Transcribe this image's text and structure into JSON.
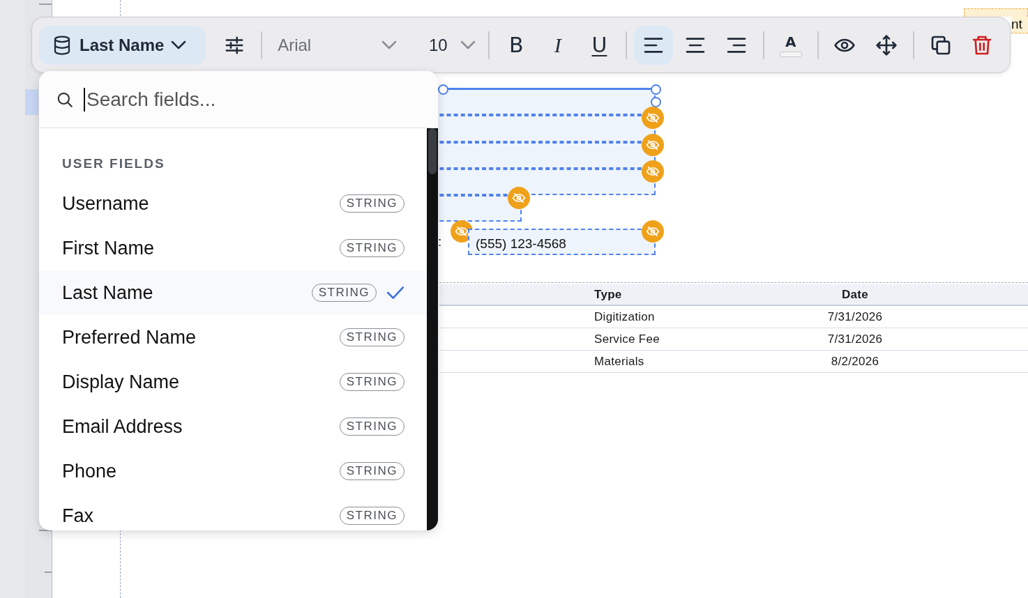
{
  "toolbar": {
    "field_button": {
      "label": "Last Name"
    },
    "font": {
      "value": "Arial"
    },
    "size": {
      "value": "10"
    },
    "tool_groups": [
      [
        {
          "kind": "bold",
          "glyph": "B"
        },
        {
          "kind": "italic",
          "glyph": "I"
        },
        {
          "kind": "underline",
          "glyph": "U"
        }
      ],
      [
        {
          "kind": "align-left",
          "selected": true
        },
        {
          "kind": "align-center",
          "selected": false
        },
        {
          "kind": "align-right",
          "selected": false
        }
      ],
      [
        {
          "kind": "text-color",
          "glyph": "A"
        }
      ],
      [
        {
          "kind": "visibility"
        },
        {
          "kind": "move"
        }
      ],
      [
        {
          "kind": "duplicate"
        },
        {
          "kind": "delete"
        }
      ]
    ]
  },
  "field_picker": {
    "search": {
      "placeholder": "Search fields..."
    },
    "section": "USER FIELDS",
    "items": [
      {
        "label": "Username",
        "type": "STRING",
        "selected": false
      },
      {
        "label": "First Name",
        "type": "STRING",
        "selected": false
      },
      {
        "label": "Last Name",
        "type": "STRING",
        "selected": true
      },
      {
        "label": "Preferred Name",
        "type": "STRING",
        "selected": false
      },
      {
        "label": "Display Name",
        "type": "STRING",
        "selected": false
      },
      {
        "label": "Email Address",
        "type": "STRING",
        "selected": false
      },
      {
        "label": "Phone",
        "type": "STRING",
        "selected": false
      },
      {
        "label": "Fax",
        "type": "STRING",
        "selected": false
      }
    ]
  },
  "canvas": {
    "top_field": {
      "value": "nt"
    },
    "fields": [
      {
        "selected": true,
        "hidden": false
      },
      {
        "selected": false,
        "hidden": true
      },
      {
        "selected": false,
        "hidden": true
      },
      {
        "selected": false,
        "hidden": true
      },
      {
        "selected": false,
        "hidden": true
      },
      {
        "selected": false,
        "hidden": true,
        "label": ":"
      },
      {
        "selected": false,
        "hidden": true,
        "value": "(555) 123-4568"
      }
    ],
    "table": {
      "columns": [
        "Type",
        "Date"
      ],
      "rows": [
        [
          "Digitization",
          "7/31/2026"
        ],
        [
          "Service Fee",
          "7/31/2026"
        ],
        [
          "Materials",
          "8/2/2026"
        ]
      ]
    }
  }
}
